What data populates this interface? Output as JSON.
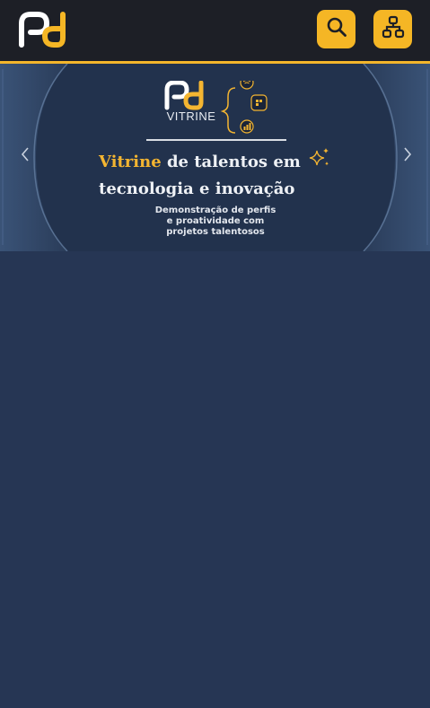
{
  "header": {
    "logo_text": "Pd",
    "search_icon": "search-icon",
    "network_icon": "sitemap-icon"
  },
  "banner": {
    "brand": "VITRINE",
    "headline_accent": "Vitrine",
    "headline_rest_line1": " de talentos em",
    "headline_line2": "tecnologia e inovação",
    "sub_line1": "Demonstração de perfis",
    "sub_line2": "e proatividade com",
    "sub_line3": "projetos talentosos",
    "prev_icon": "chevron-left-icon",
    "next_icon": "chevron-right-icon"
  },
  "colors": {
    "header_bg": "#1d1f26",
    "accent": "#f5b625",
    "page_bg": "#263654"
  }
}
